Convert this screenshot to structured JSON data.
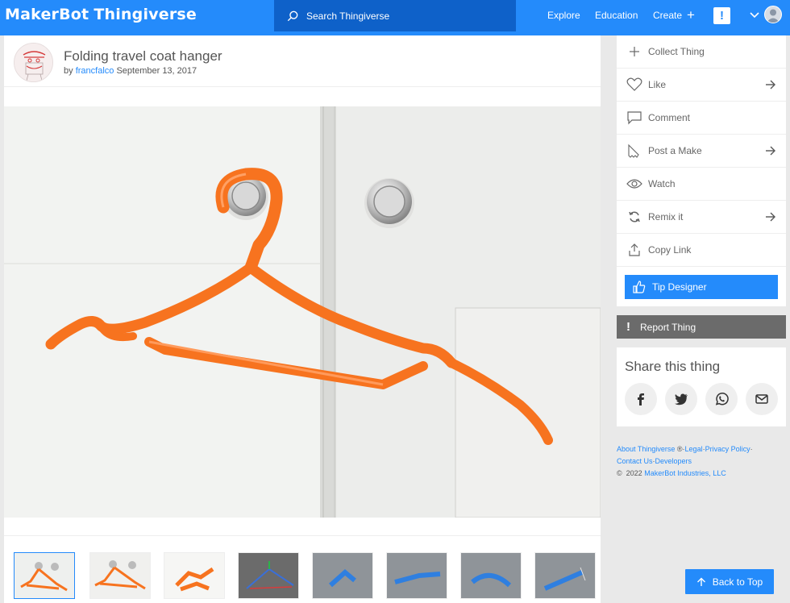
{
  "topbar": {
    "logo_part1": "MakerBot",
    "logo_part2": "Thingiverse",
    "search_placeholder": "Search Thingiverse",
    "nav": {
      "explore": "Explore",
      "education": "Education",
      "create": "Create"
    },
    "alert_label": "!"
  },
  "thing": {
    "title": "Folding travel coat hanger",
    "by_label": "by",
    "author": "francfalco",
    "date": "September 13, 2017"
  },
  "actions": {
    "collect": "Collect Thing",
    "like": "Like",
    "comment": "Comment",
    "post_make": "Post a Make",
    "watch": "Watch",
    "remix": "Remix it",
    "copy_link": "Copy Link",
    "tip": "Tip Designer"
  },
  "report": {
    "label": "Report Thing"
  },
  "share": {
    "title": "Share this thing"
  },
  "footer": {
    "about": "About Thingiverse",
    "registered": "®",
    "legal": "Legal",
    "privacy": "Privacy Policy",
    "contact": "Contact Us",
    "developers": "Developers",
    "dot": "·",
    "copyright_symbol": "©",
    "year": "2022",
    "company": "MakerBot Industries, LLC"
  },
  "back_to_top": "Back to Top",
  "colors": {
    "brand_blue": "#248bfb",
    "search_bg": "#0e61c9",
    "report_bg": "#6b6b6b",
    "hanger_orange": "#f7731f"
  }
}
